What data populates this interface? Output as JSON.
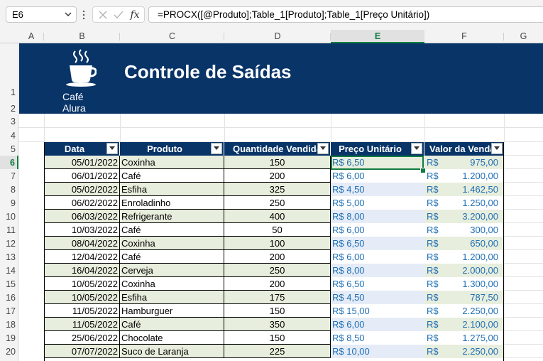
{
  "formula_bar": {
    "name_box": "E6",
    "fx_label": "fx",
    "formula": "=PROCX([@Produto];Table_1[Produto];Table_1[Preço Unitário])"
  },
  "columns": [
    "A",
    "B",
    "C",
    "D",
    "E",
    "F",
    "G"
  ],
  "selected_column": "E",
  "rows": [
    "1",
    "2",
    "3",
    "4",
    "5",
    "6",
    "7",
    "8",
    "9",
    "10",
    "11",
    "12",
    "13",
    "14",
    "15",
    "16",
    "17",
    "18",
    "19",
    "20"
  ],
  "selected_row": "6",
  "banner": {
    "logo_line1": "Café",
    "logo_line2": "Alura",
    "title": "Controle de Saídas",
    "bg_color": "#083468"
  },
  "table": {
    "headers": [
      "Data",
      "Produto",
      "Quantidade Vendida",
      "Preço Unitário",
      "Valor da Venda"
    ],
    "rows": [
      {
        "date": "05/01/2022",
        "product": "Coxinha",
        "qty": "150",
        "price": "R$ 6,50",
        "cur": "R$",
        "total": "975,00"
      },
      {
        "date": "06/01/2022",
        "product": "Café",
        "qty": "200",
        "price": "R$ 6,00",
        "cur": "R$",
        "total": "1.200,00"
      },
      {
        "date": "05/02/2022",
        "product": "Esfiha",
        "qty": "325",
        "price": "R$ 4,50",
        "cur": "R$",
        "total": "1.462,50"
      },
      {
        "date": "06/02/2022",
        "product": "Enroladinho",
        "qty": "250",
        "price": "R$ 5,00",
        "cur": "R$",
        "total": "1.250,00"
      },
      {
        "date": "06/03/2022",
        "product": "Refrigerante",
        "qty": "400",
        "price": "R$ 8,00",
        "cur": "R$",
        "total": "3.200,00"
      },
      {
        "date": "10/03/2022",
        "product": "Café",
        "qty": "50",
        "price": "R$ 6,00",
        "cur": "R$",
        "total": "300,00"
      },
      {
        "date": "08/04/2022",
        "product": "Coxinha",
        "qty": "100",
        "price": "R$ 6,50",
        "cur": "R$",
        "total": "650,00"
      },
      {
        "date": "12/04/2022",
        "product": "Café",
        "qty": "200",
        "price": "R$ 6,00",
        "cur": "R$",
        "total": "1.200,00"
      },
      {
        "date": "16/04/2022",
        "product": "Cerveja",
        "qty": "250",
        "price": "R$ 8,00",
        "cur": "R$",
        "total": "2.000,00"
      },
      {
        "date": "10/05/2022",
        "product": "Coxinha",
        "qty": "200",
        "price": "R$ 6,50",
        "cur": "R$",
        "total": "1.300,00"
      },
      {
        "date": "10/05/2022",
        "product": "Esfiha",
        "qty": "175",
        "price": "R$ 4,50",
        "cur": "R$",
        "total": "787,50"
      },
      {
        "date": "11/05/2022",
        "product": "Hamburguer",
        "qty": "150",
        "price": "R$ 15,00",
        "cur": "R$",
        "total": "2.250,00"
      },
      {
        "date": "11/05/2022",
        "product": "Café",
        "qty": "350",
        "price": "R$ 6,00",
        "cur": "R$",
        "total": "2.100,00"
      },
      {
        "date": "25/06/2022",
        "product": "Chocolate",
        "qty": "150",
        "price": "R$ 8,50",
        "cur": "R$",
        "total": "1.275,00"
      },
      {
        "date": "07/07/2022",
        "product": "Suco de Laranja",
        "qty": "225",
        "price": "R$ 10,00",
        "cur": "R$",
        "total": "2.250,00"
      }
    ]
  },
  "colors": {
    "selection": "#107c41",
    "band_green": "#e8eedd",
    "band_blue": "#e5ecf7",
    "currency_text": "#1f6fb5"
  }
}
